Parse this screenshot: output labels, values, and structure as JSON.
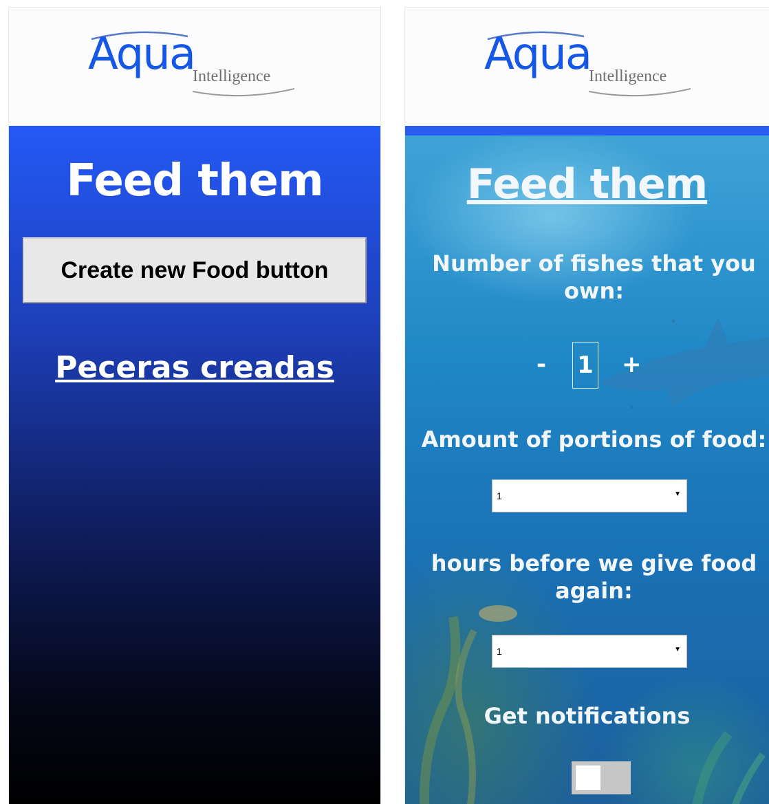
{
  "brand": {
    "logo_main": "Aqua",
    "logo_sub": "Intelligence"
  },
  "left_screen": {
    "title": "Feed them",
    "create_button_label": "Create new Food button",
    "peceras_link": "Peceras creadas"
  },
  "right_screen": {
    "title": "Feed them",
    "fishes_label": "Number of fishes that you own:",
    "fishes_stepper": {
      "minus_label": "-",
      "value": "1",
      "plus_label": "+"
    },
    "portions_label": "Amount of portions of food:",
    "portions_select_value": "1",
    "hours_label": "hours before we give food again:",
    "hours_select_value": "1",
    "notifications_label": "Get notifications",
    "notifications_enabled": false
  },
  "colors": {
    "brand_blue": "#1558e6",
    "header_bar_blue": "#2a5cf0",
    "toggle_off": "#c6c6c6"
  },
  "icons": {
    "select_arrow": "dropdown-arrow-icon"
  }
}
